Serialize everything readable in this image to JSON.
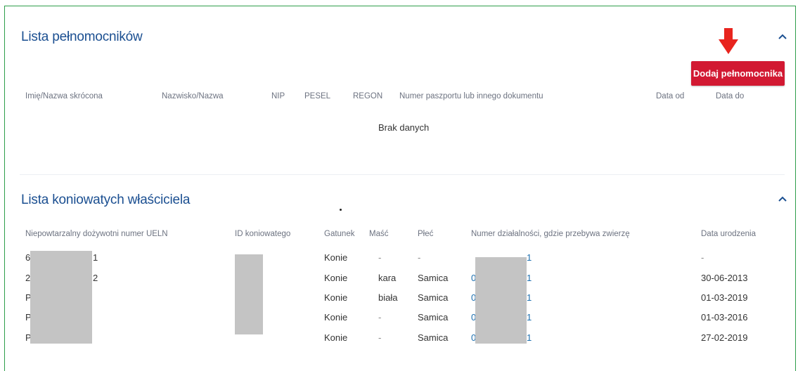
{
  "proxies": {
    "title": "Lista pełnomocników",
    "add_button": "Dodaj pełnomocnika",
    "columns": [
      "Imię/Nazwa skrócona",
      "Nazwisko/Nazwa",
      "NIP",
      "PESEL",
      "REGON",
      "Numer paszportu lub innego dokumentu",
      "Data od",
      "Data do"
    ],
    "empty_text": "Brak danych"
  },
  "horses": {
    "title": "Lista koniowatych właściciela",
    "columns": [
      "Niepowtarzalny dożywotni numer UELN",
      "ID koniowatego",
      "Gatunek",
      "Maść",
      "Płeć",
      "Numer działalności, gdzie przebywa zwierzę",
      "Data urodzenia"
    ],
    "rows": [
      {
        "ueln_start": "6",
        "ueln_end": "1",
        "id": "",
        "species": "Konie",
        "color": "-",
        "sex": "-",
        "activity_end": "1",
        "birth_date": "-"
      },
      {
        "ueln_start": "2",
        "ueln_end": "2",
        "id": "",
        "species": "Konie",
        "color": "kara",
        "sex": "Samica",
        "activity_start": "0",
        "activity_end": "1",
        "birth_date": "30-06-2013"
      },
      {
        "ueln_start": "P",
        "ueln_end": "",
        "id": "",
        "species": "Konie",
        "color": "biała",
        "sex": "Samica",
        "activity_start": "0",
        "activity_end": "1",
        "birth_date": "01-03-2019"
      },
      {
        "ueln_start": "P",
        "ueln_end": "",
        "id": "",
        "species": "Konie",
        "color": "-",
        "sex": "Samica",
        "activity_start": "0",
        "activity_end": "1",
        "birth_date": "01-03-2016"
      },
      {
        "ueln_start": "P",
        "ueln_end": "",
        "id": "",
        "species": "Konie",
        "color": "-",
        "sex": "Samica",
        "activity_start": "0",
        "activity_end": "1",
        "birth_date": "27-02-2019"
      }
    ]
  },
  "colors": {
    "title": "#1b4f91",
    "button": "#d21932",
    "arrow": "#e8241e",
    "frame": "#2e9e4a",
    "link": "#1b6fb0"
  },
  "icons": {
    "collapse": "chevron-up-icon",
    "pointer": "arrow-down-icon"
  }
}
